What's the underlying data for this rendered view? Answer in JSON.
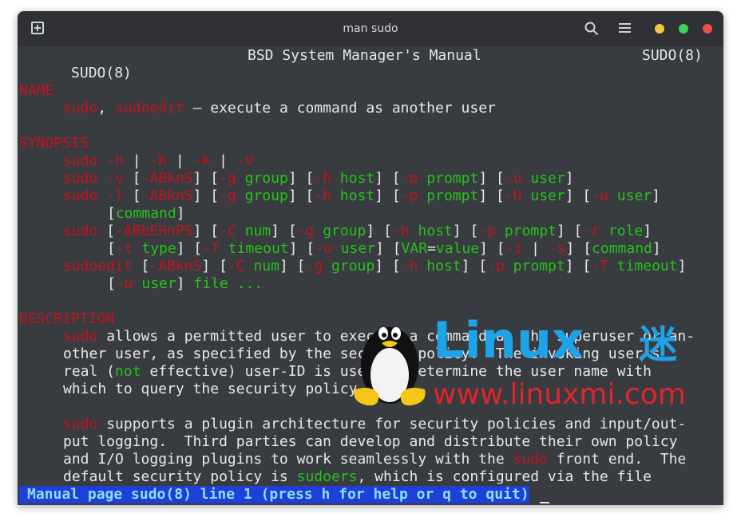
{
  "window": {
    "title": "man sudo",
    "controls": {
      "minimize_color": "#f5c543",
      "maximize_color": "#3fd05a",
      "close_color": "#ee4d4d"
    }
  },
  "icons": [
    "new-tab-icon",
    "search-icon",
    "hamburger-menu-icon"
  ],
  "manpage": {
    "header_left": "SUDO(8)",
    "header_center": "BSD System Manager's Manual",
    "header_right": "SUDO(8)",
    "sections": {
      "name": "NAME",
      "synopsis": "SYNOPSIS",
      "description": "DESCRIPTION"
    },
    "name_line": {
      "cmd1": "sudo",
      "sep": ", ",
      "cmd2": "sudoedit",
      "desc": " — execute a command as another user"
    },
    "description_lines": {
      "p1_l1_cmd": "sudo",
      "p1_l1": " allows a permitted user to execute a command as the superuser or an-",
      "p1_l2": "other user, as specified by the security policy.  The invoking user's",
      "p1_l3_a": "real (",
      "p1_l3_not": "not",
      "p1_l3_b": " effective) user-ID is used to determine the user name with",
      "p1_l4": "which to query the security policy.",
      "p2_l1_cmd": "sudo",
      "p2_l1": " supports a plugin architecture for security policies and input/out-",
      "p2_l2": "put logging.  Third parties can develop and distribute their own policy",
      "p2_l3_a": "and I/O logging plugins to work seamlessly with the ",
      "p2_l3_cmd": "sudo",
      "p2_l3_b": " front end.  The",
      "p2_l4_a": "default security policy is ",
      "p2_l4_sudoers": "sudoers",
      "p2_l4_b": ", which is configured via the file"
    }
  },
  "status_bar": "Manual page sudo(8) line 1 (press h for help or q to quit)",
  "watermark": {
    "brand": "Linux",
    "suffix": "迷",
    "url": "www.linuxmi.com"
  },
  "colors": {
    "bold_red": "#c4141b",
    "underline_green": "#26c21a",
    "status_bg": "#1e3fd8",
    "status_fg": "#8de0f3"
  }
}
